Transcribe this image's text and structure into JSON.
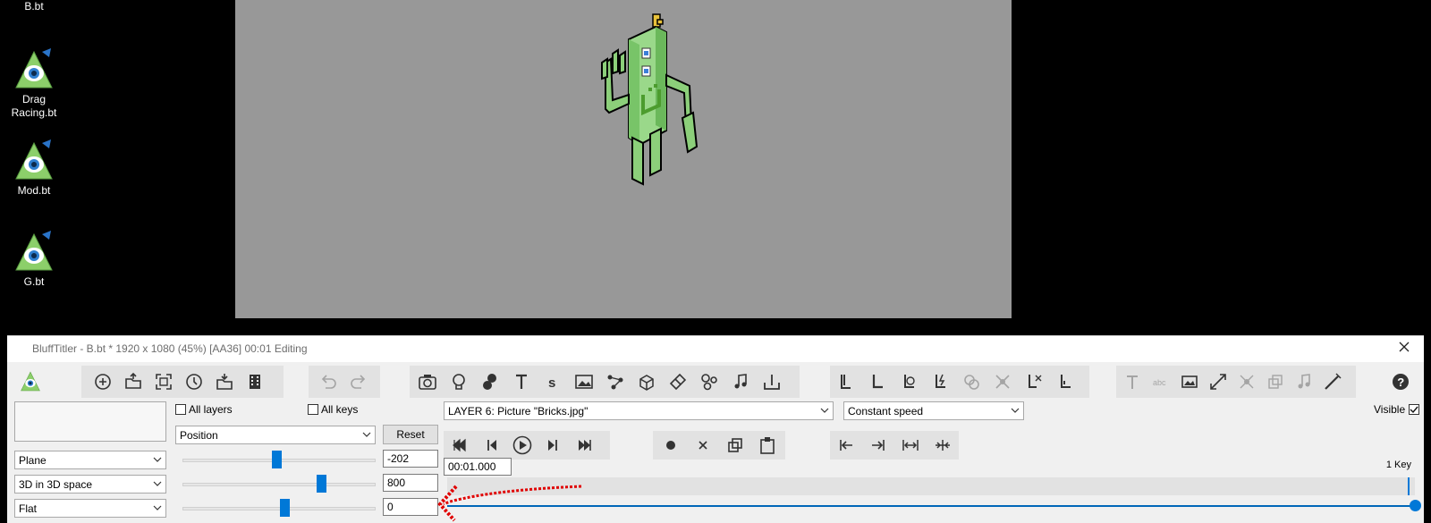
{
  "desktop": {
    "icons": [
      {
        "label": "B.bt"
      },
      {
        "label": "Drag Racing.bt"
      },
      {
        "label": "Mod.bt"
      },
      {
        "label": "G.bt"
      }
    ]
  },
  "window": {
    "title": "BluffTitler - B.bt * 1920 x 1080 (45%) [AA36] 00:01 Editing"
  },
  "toolbar": {
    "file_group": [
      "add-icon",
      "open-icon",
      "resize-icon",
      "clock-icon",
      "open-folder-icon",
      "film-icon"
    ],
    "history_group": [
      "undo-icon",
      "redo-icon"
    ],
    "layer_group": [
      "camera-icon",
      "light-icon",
      "shape-icon",
      "text-icon",
      "small-text-icon",
      "picture-icon",
      "path-icon",
      "box-icon",
      "eraser-icon",
      "particles-icon",
      "music-icon",
      "dock-icon"
    ],
    "layer_link_group": [
      "link-icon",
      "link2-icon",
      "link-loop-icon",
      "link-lightning-icon",
      "link-disabled-icon",
      "scatter-disabled-icon",
      "link-x-icon",
      "link-l-icon"
    ],
    "fx_group": [
      "text-fx-disabled-icon",
      "abc-disabled-icon",
      "picture-fx-icon",
      "expand-icon",
      "network-disabled-icon",
      "copy-disabled-icon",
      "music-disabled-icon",
      "magic-wand-icon"
    ],
    "help_icon": "help-icon"
  },
  "left_panel": {
    "all_layers_label": "All layers",
    "all_keys_label": "All keys",
    "property_select": "Position",
    "reset_label": "Reset",
    "dropdowns": [
      "Plane",
      "3D in 3D space",
      "Flat"
    ],
    "values": [
      "-202",
      "800",
      "0"
    ],
    "slider_positions": [
      0.45,
      0.68,
      0.49
    ]
  },
  "layer_panel": {
    "layer_select": "LAYER   6: Picture \"Bricks.jpg\"",
    "speed_select": "Constant speed",
    "visible_label": "Visible",
    "visible_checked": true,
    "time_value": "00:01.000",
    "keys_label": "1 Key"
  },
  "colors": {
    "accent": "#0078d7",
    "annotation": "#e00000"
  }
}
